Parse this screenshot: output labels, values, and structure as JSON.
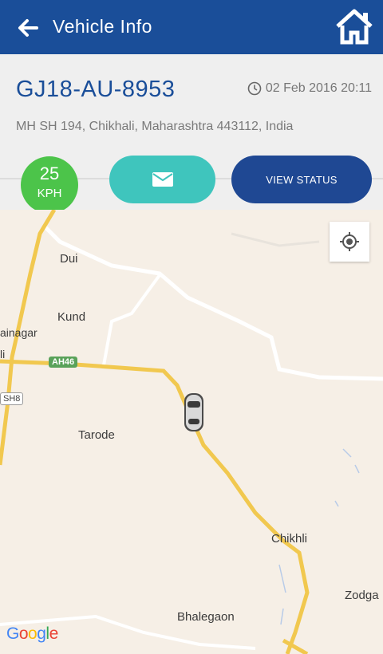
{
  "appbar": {
    "title": "Vehicle Info",
    "back_icon": "arrow-left-icon",
    "home_icon": "home-icon"
  },
  "vehicle": {
    "plate": "GJ18-AU-8953",
    "timestamp": "02 Feb 2016 20:11",
    "address": "MH SH 194, Chikhali, Maharashtra 443112, India",
    "speed_value": "25",
    "speed_unit": "KPH"
  },
  "actions": {
    "message_icon": "envelope-icon",
    "view_status_label": "VIEW STATUS"
  },
  "map": {
    "places": [
      "Dui",
      "Kund",
      "ainagar",
      "li",
      "Tarode",
      "Chikhli",
      "Zodga",
      "Bhalegaon"
    ],
    "road_shields": [
      "AH46",
      "SH8"
    ],
    "attribution": "Google"
  },
  "colors": {
    "brand": "#1a4e99",
    "speed": "#4cc44a",
    "message": "#3fc5bd",
    "status": "#1f4893"
  }
}
